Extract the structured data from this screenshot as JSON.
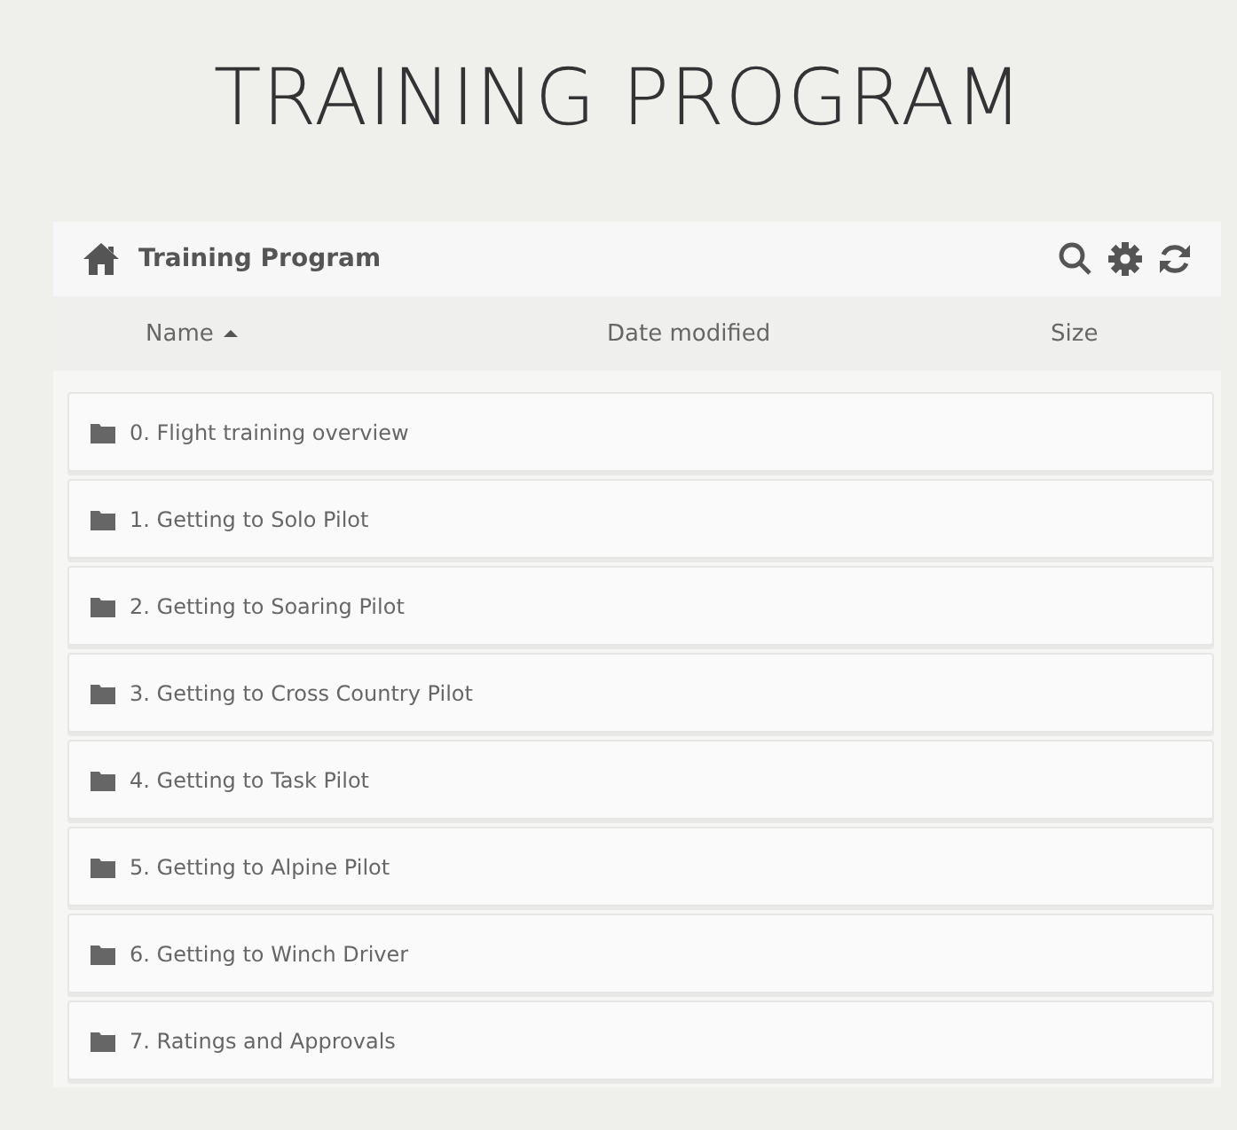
{
  "page_title": "TRAINING PROGRAM",
  "panel": {
    "title": "Training Program",
    "columns": [
      {
        "label": "Name",
        "sorted": true
      },
      {
        "label": "Date modified",
        "sorted": false
      },
      {
        "label": "Size",
        "sorted": false
      }
    ],
    "rows": [
      {
        "kind": "folder",
        "name": "0. Flight training overview"
      },
      {
        "kind": "folder",
        "name": "1. Getting to Solo Pilot"
      },
      {
        "kind": "folder",
        "name": "2. Getting to Soaring Pilot"
      },
      {
        "kind": "folder",
        "name": "3. Getting to Cross Country Pilot"
      },
      {
        "kind": "folder",
        "name": "4. Getting to Task Pilot"
      },
      {
        "kind": "folder",
        "name": "5. Getting to Alpine Pilot"
      },
      {
        "kind": "folder",
        "name": "6. Getting to Winch Driver"
      },
      {
        "kind": "folder",
        "name": "7. Ratings and Approvals"
      }
    ]
  }
}
